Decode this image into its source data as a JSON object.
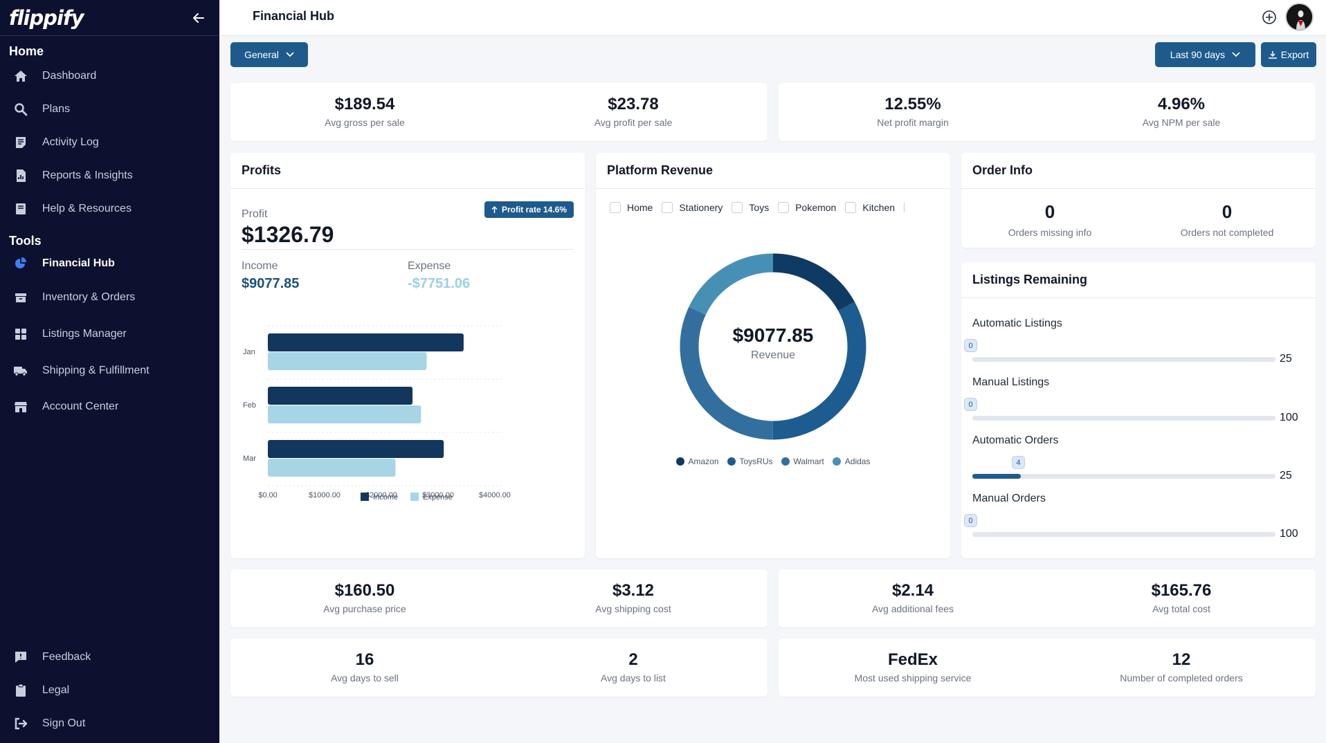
{
  "app": {
    "logo": "flippify",
    "page_title": "Financial Hub"
  },
  "sidebar": {
    "home_title": "Home",
    "home_items": [
      {
        "label": "Dashboard",
        "icon": "home-icon"
      },
      {
        "label": "Plans",
        "icon": "search-icon"
      },
      {
        "label": "Activity Log",
        "icon": "activity-icon"
      },
      {
        "label": "Reports & Insights",
        "icon": "report-icon"
      },
      {
        "label": "Help & Resources",
        "icon": "help-book-icon"
      }
    ],
    "tools_title": "Tools",
    "tools_items": [
      {
        "label": "Financial Hub",
        "icon": "pie-chart-icon",
        "active": true
      },
      {
        "label": "Inventory & Orders",
        "icon": "box-icon"
      },
      {
        "label": "Listings Manager",
        "icon": "grid-icon"
      },
      {
        "label": "Shipping & Fulfillment",
        "icon": "truck-icon"
      },
      {
        "label": "Account Center",
        "icon": "store-icon"
      }
    ],
    "bottom_items": [
      {
        "label": "Feedback",
        "icon": "feedback-icon"
      },
      {
        "label": "Legal",
        "icon": "clipboard-icon"
      },
      {
        "label": "Sign Out",
        "icon": "sign-out-icon"
      }
    ]
  },
  "toolbar": {
    "category": "General",
    "range": "Last 90 days",
    "export": "Export"
  },
  "top_stats": [
    {
      "value": "$189.54",
      "label": "Avg gross per sale"
    },
    {
      "value": "$23.78",
      "label": "Avg profit per sale"
    },
    {
      "value": "12.55%",
      "label": "Net profit margin"
    },
    {
      "value": "4.96%",
      "label": "Avg NPM per sale"
    }
  ],
  "profits": {
    "title": "Profits",
    "profit_label": "Profit",
    "profit_value": "$1326.79",
    "rate_badge": "Profit rate 14.6%",
    "income_label": "Income",
    "income_value": "$9077.85",
    "expense_label": "Expense",
    "expense_value": "-$7751.06"
  },
  "chart_data": {
    "type": "bar",
    "orientation": "horizontal",
    "categories": [
      "Jan",
      "Feb",
      "Mar"
    ],
    "series": [
      {
        "name": "Income",
        "values": [
          3450,
          2550,
          3100
        ],
        "color": "#12365c"
      },
      {
        "name": "Expense",
        "values": [
          2800,
          2700,
          2250
        ],
        "color": "#a8d5e6"
      }
    ],
    "xlim": [
      0,
      4000
    ],
    "x_ticks": [
      "$0.00",
      "$1000.00",
      "$2000.00",
      "$3000.00",
      "$4000.00"
    ],
    "legend": "bottom-center",
    "grid": "dashed"
  },
  "platform_revenue": {
    "title": "Platform Revenue",
    "filters": [
      "Home",
      "Stationery",
      "Toys",
      "Pokemon",
      "Kitchen"
    ],
    "center_value": "$9077.85",
    "center_label": "Revenue",
    "donut": [
      {
        "name": "Amazon",
        "share": 0.17,
        "color": "#0f3a63"
      },
      {
        "name": "ToysRUs",
        "share": 0.33,
        "color": "#1d5c91"
      },
      {
        "name": "Walmart",
        "share": 0.32,
        "color": "#336f9e"
      },
      {
        "name": "Adidas",
        "share": 0.18,
        "color": "#4790b5"
      }
    ]
  },
  "order_info": {
    "title": "Order Info",
    "missing_value": "0",
    "missing_label": "Orders missing info",
    "incomplete_value": "0",
    "incomplete_label": "Orders not completed"
  },
  "listings_remaining": {
    "title": "Listings Remaining",
    "rows": [
      {
        "label": "Automatic Listings",
        "used": "0",
        "max": "25",
        "fraction": 0
      },
      {
        "label": "Manual Listings",
        "used": "0",
        "max": "100",
        "fraction": 0
      },
      {
        "label": "Automatic Orders",
        "used": "4",
        "max": "25",
        "fraction": 0.16
      },
      {
        "label": "Manual Orders",
        "used": "0",
        "max": "100",
        "fraction": 0
      }
    ]
  },
  "cost_stats": [
    {
      "value": "$160.50",
      "label": "Avg purchase price"
    },
    {
      "value": "$3.12",
      "label": "Avg shipping cost"
    },
    {
      "value": "$2.14",
      "label": "Avg additional fees"
    },
    {
      "value": "$165.76",
      "label": "Avg total cost"
    }
  ],
  "other_stats": [
    {
      "value": "16",
      "label": "Avg days to sell"
    },
    {
      "value": "2",
      "label": "Avg days to list"
    },
    {
      "value": "FedEx",
      "label": "Most used shipping service"
    },
    {
      "value": "12",
      "label": "Number of completed orders"
    }
  ]
}
